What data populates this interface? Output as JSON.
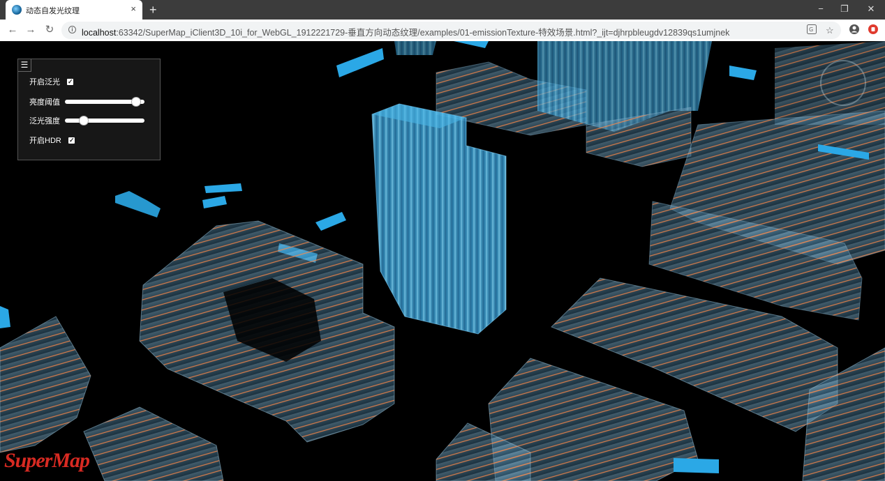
{
  "browser": {
    "tab_title": "动态自发光纹理",
    "tab_close": "×",
    "new_tab": "+",
    "url_host": "localhost",
    "url_rest": ":63342/SuperMap_iClient3D_10i_for_WebGL_1912221729-垂直方向动态纹理/examples/01-emissionTexture-特效场景.html?_ijt=djhrpbleugdv12839qs1umjnek",
    "back": "←",
    "forward": "→",
    "reload": "↻",
    "minimize": "−",
    "restore": "❐",
    "close": "✕"
  },
  "panel": {
    "menu_icon": "☰",
    "bloom_label": "开启泛光",
    "bloom_checked": true,
    "threshold_label": "亮度阈值",
    "threshold_value": 0.95,
    "intensity_label": "泛光强度",
    "intensity_value": 0.2,
    "hdr_label": "开启HDR",
    "hdr_checked": true
  },
  "logo_text": "SuperMap",
  "colors": {
    "building_blue": "#3aa6e0",
    "glow_orange": "#ff7a3a",
    "logo_red": "#d82a22"
  }
}
